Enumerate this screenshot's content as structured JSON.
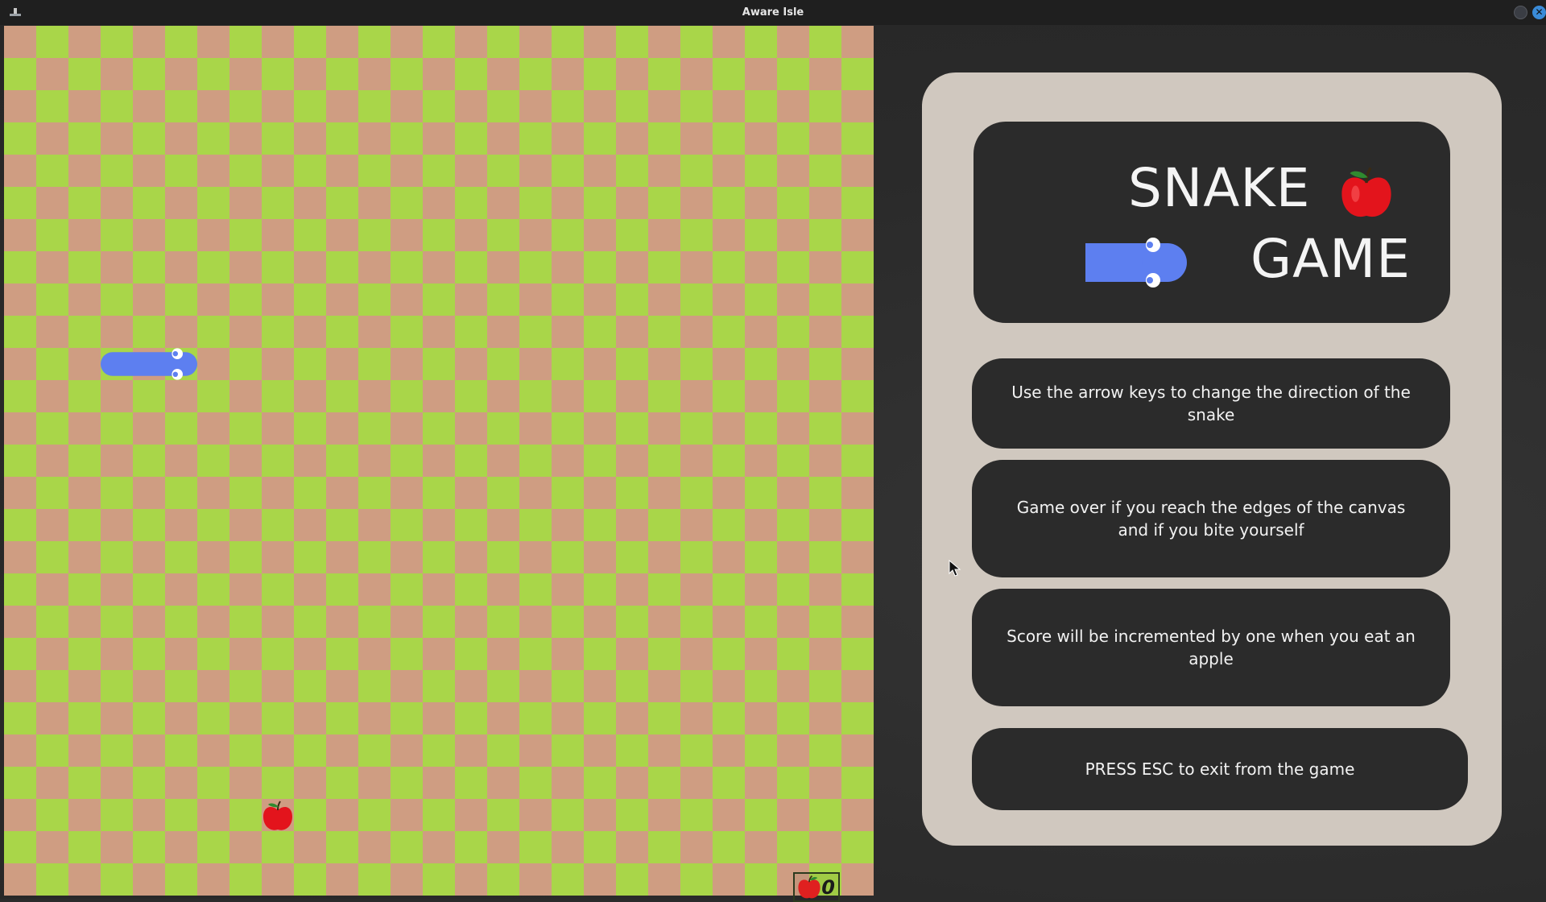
{
  "window": {
    "title": "Aware Isle"
  },
  "game": {
    "board": {
      "cols": 27,
      "rows": 27,
      "color_light": "#a9d649",
      "color_dark": "#cf9d82",
      "snake": {
        "head_col": 5,
        "head_row": 10,
        "length": 3,
        "direction": "right",
        "color": "#5d7ff0"
      },
      "apple": {
        "col": 8,
        "row": 24
      }
    },
    "score": {
      "value": "0",
      "icon": "apple-icon"
    }
  },
  "panel": {
    "title_line1": "SNAKE",
    "title_line2": "GAME",
    "instructions": [
      "Use the arrow keys to change the direction of the snake",
      "Game over if you reach the edges of the canvas and if you bite yourself",
      "Score will be incremented by one when you eat an apple"
    ],
    "exit_hint": "PRESS ESC to exit from the game"
  },
  "colors": {
    "panel_bg": "#d0c8bf",
    "card_bg": "#2b2b2b",
    "snake": "#5d7ff0",
    "apple": "#e02020"
  }
}
